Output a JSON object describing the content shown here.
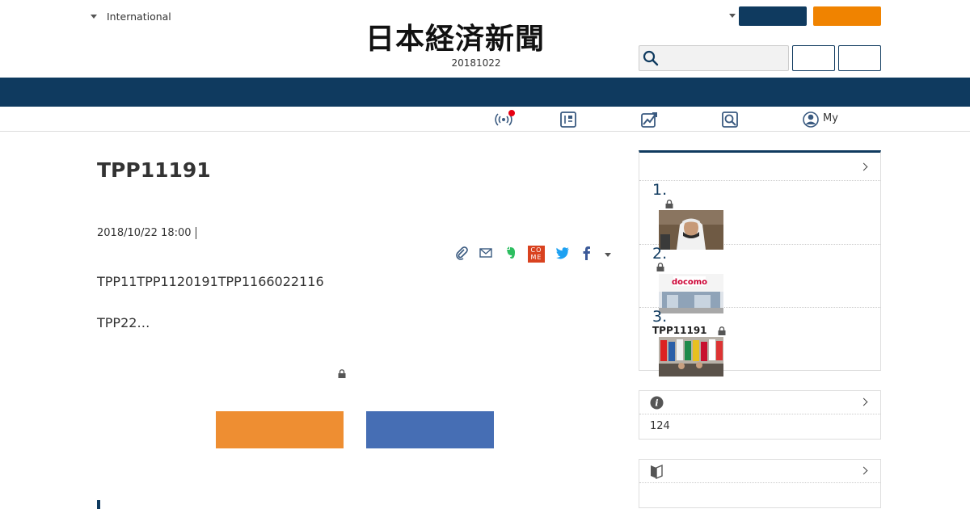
{
  "header": {
    "region_label": "International",
    "logo_text": "日本経済新聞",
    "edition_date": "20181022",
    "search_placeholder": ""
  },
  "subnav": {
    "items": [
      {
        "icon": "broadcast-icon",
        "has_notification": true
      },
      {
        "icon": "newspaper-icon"
      },
      {
        "icon": "chart-icon"
      },
      {
        "icon": "search-icon"
      },
      {
        "icon": "user-icon",
        "label": "My"
      }
    ]
  },
  "article": {
    "title": "TPP11191",
    "date": "2018/10/22 18:00",
    "lead": "TPP11TPP1120191TPP1166022116",
    "excerpt": "TPP22…",
    "share_icons": [
      "clip-icon",
      "mail-icon",
      "evernote-icon",
      "comme-icon",
      "twitter-icon",
      "facebook-icon"
    ],
    "comme_text": "CO ME"
  },
  "ranking": {
    "items": [
      {
        "rank": "1.",
        "title": "",
        "locked": true
      },
      {
        "rank": "2.",
        "title": "",
        "locked": true
      },
      {
        "rank": "3.",
        "title": "TPP11191",
        "locked": true
      }
    ]
  },
  "info": {
    "count": "124"
  },
  "colors": {
    "navy": "#0f3a5f",
    "orange": "#f08300",
    "cta_orange": "#ee8e32",
    "cta_blue": "#466eb4"
  }
}
